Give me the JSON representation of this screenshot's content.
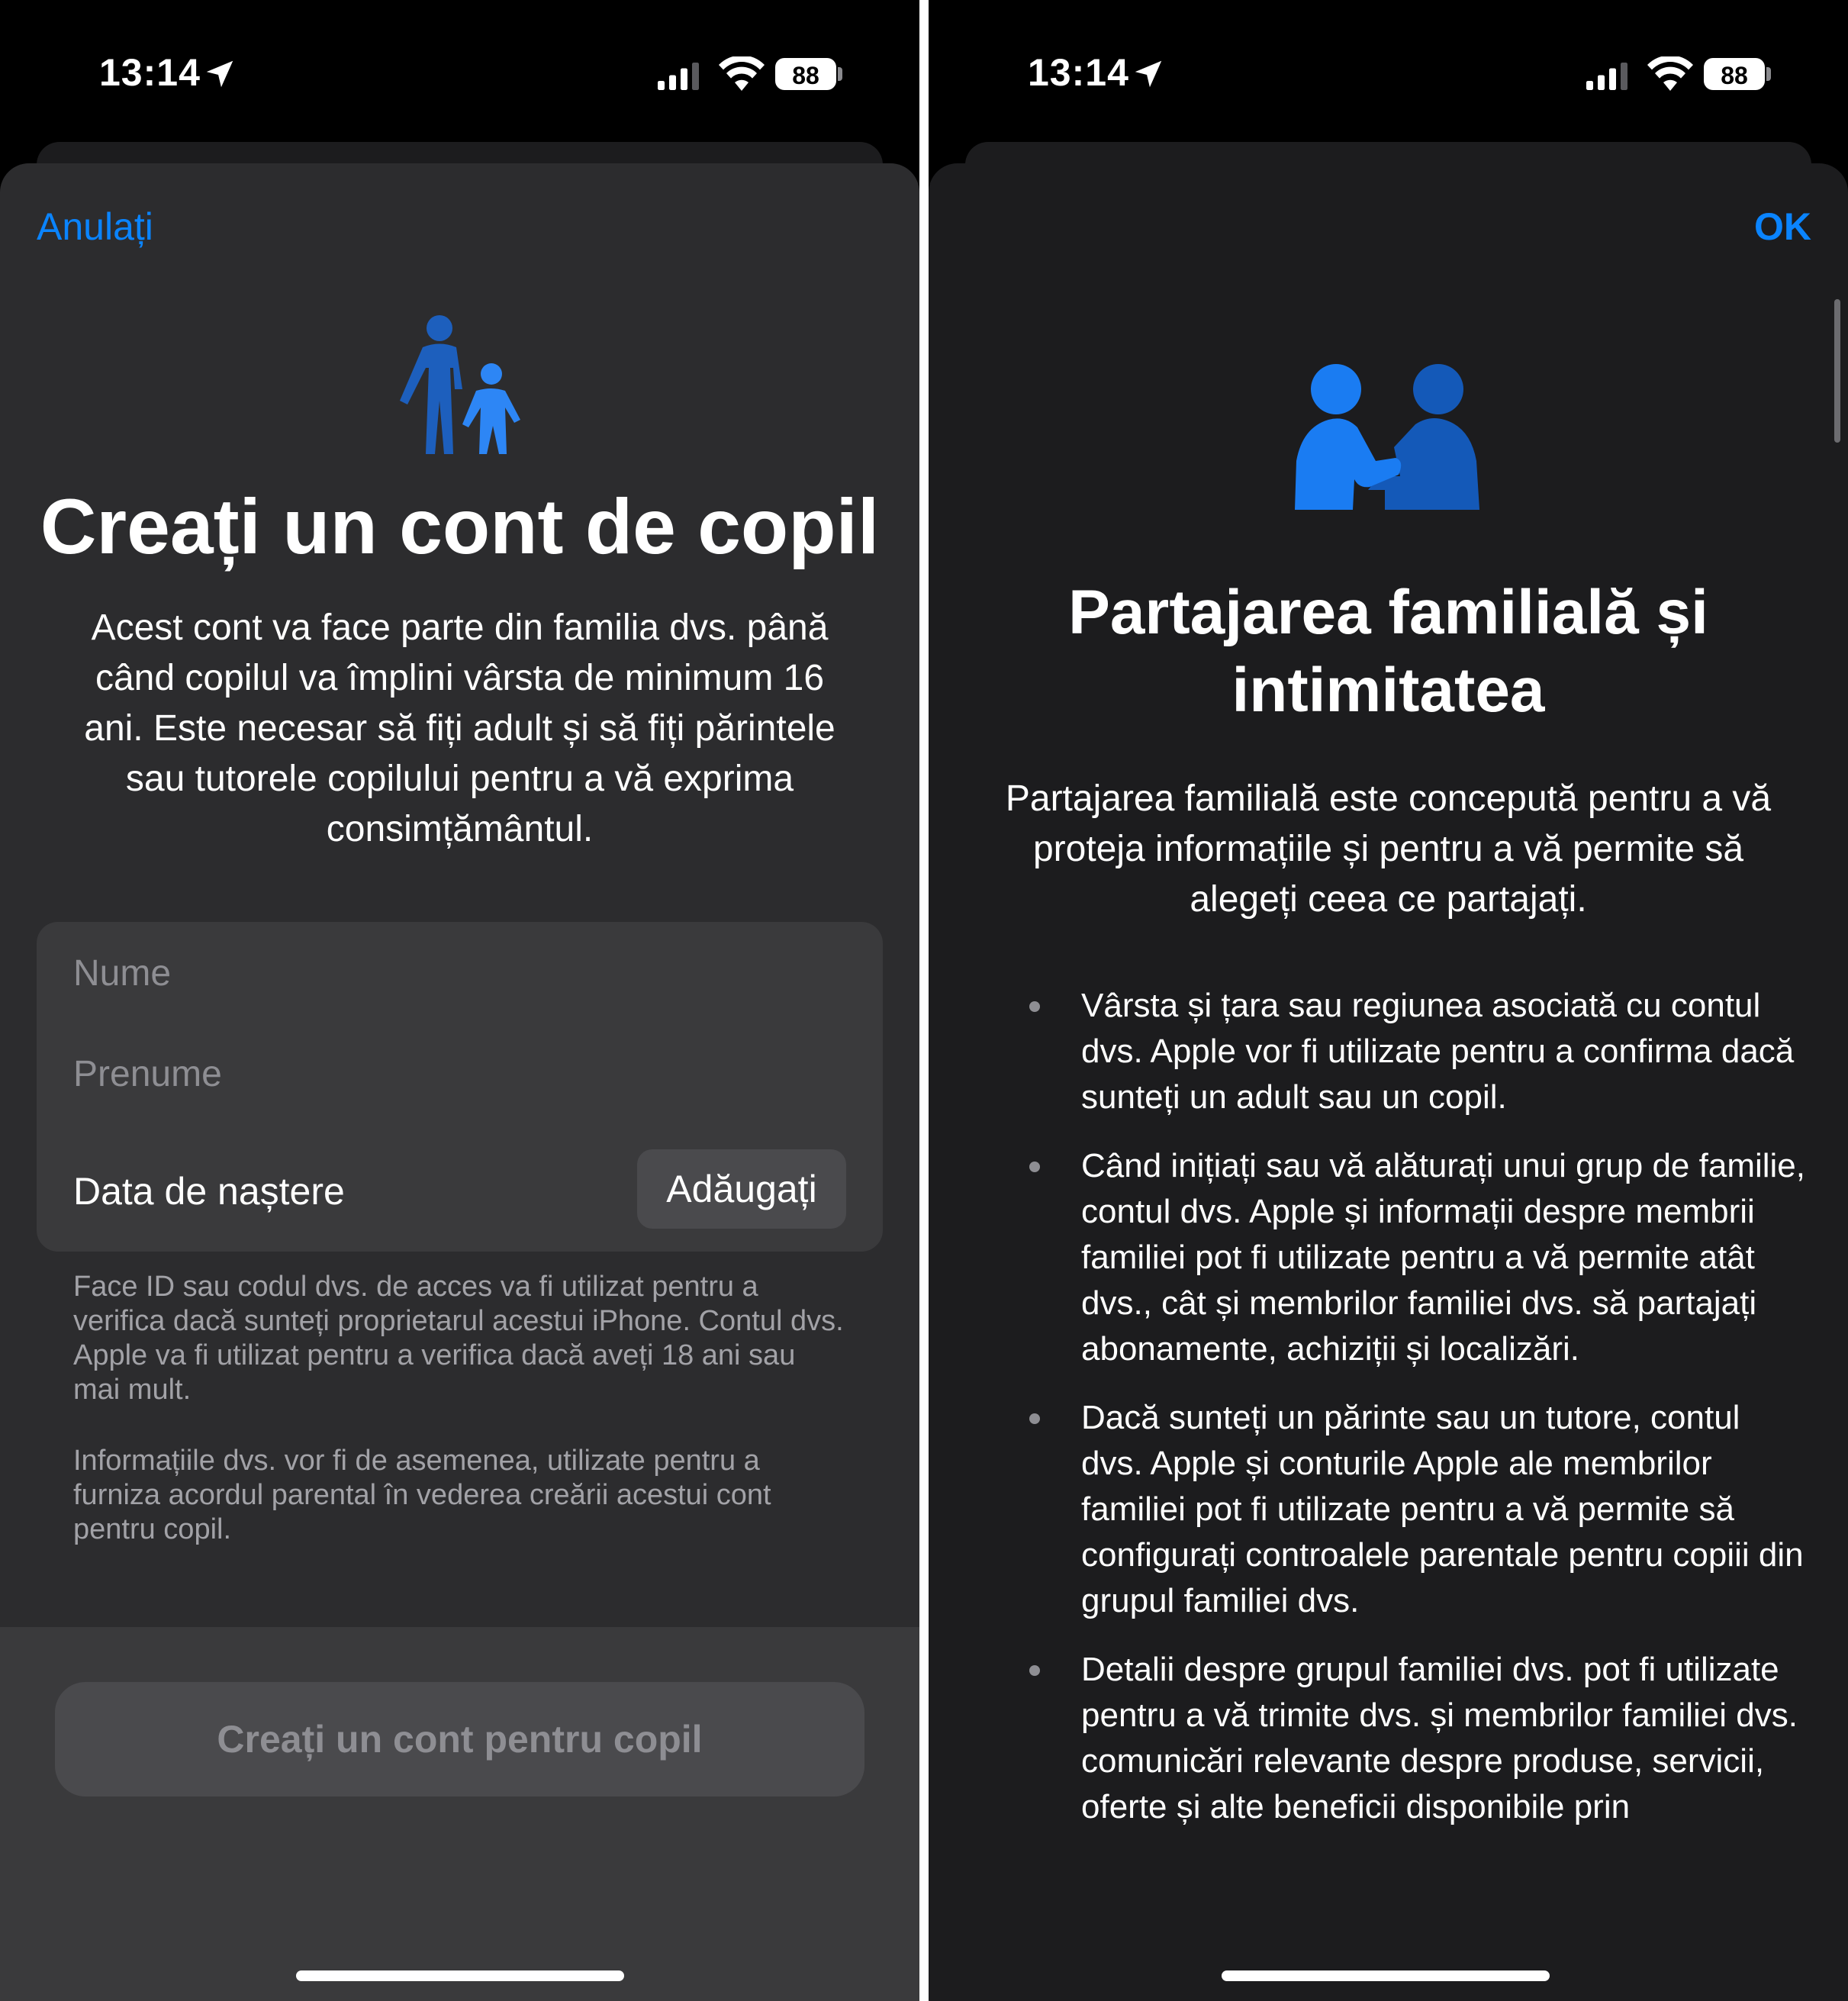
{
  "left": {
    "status": {
      "time": "13:14",
      "battery": "88"
    },
    "cancel_label": "Anulați",
    "title": "Creați un cont de copil",
    "description": "Acest cont va face parte din familia dvs. până când copilul va împlini vârsta de minimum 16 ani. Este necesar să fiți adult și să fiți părintele sau tutorele copilului pentru a vă exprima consimțământul.",
    "form": {
      "name_placeholder": "Nume",
      "surname_placeholder": "Prenume",
      "dob_label": "Data de naștere",
      "add_label": "Adăugați"
    },
    "footnote_1": "Face ID sau codul dvs. de acces va fi utilizat pentru a verifica dacă sunteți proprietarul acestui iPhone. Contul dvs. Apple va fi utilizat pentru a verifica dacă aveți 18 ani sau mai mult.",
    "footnote_2": "Informațiile dvs. vor fi de asemenea, utilizate pentru a furniza acordul parental în vederea creării acestui cont pentru copil.",
    "create_button": "Creați un cont pentru copil",
    "icon": "parent-child-icon",
    "accent_color": "#0a84ff"
  },
  "right": {
    "status": {
      "time": "13:14",
      "battery": "88"
    },
    "ok_label": "OK",
    "icon": "family-handshake-icon",
    "title": "Partajarea familială și intimitatea",
    "description": "Partajarea familială este concepută pentru a vă proteja informațiile și pentru a vă permite să alegeți ceea ce partajați.",
    "bullets": [
      "Vârsta și țara sau regiunea asociată cu contul dvs. Apple vor fi utilizate pentru a confirma dacă sunteți un adult sau un copil.",
      "Când inițiați sau vă alăturați unui grup de familie, contul dvs. Apple și informații despre membrii familiei pot fi utilizate pentru a vă permite atât dvs., cât și membrilor familiei dvs. să partajați abonamente, achiziții și localizări.",
      "Dacă sunteți un părinte sau un tutore, contul dvs. Apple și conturile Apple ale membrilor familiei pot fi utilizate pentru a vă permite să configurați controalele parentale pentru copiii din grupul familiei dvs.",
      "Detalii despre grupul familiei dvs. pot fi utilizate pentru a vă trimite dvs. și membrilor familiei dvs. comunicări relevante despre produse, servicii, oferte și alte beneficii disponibile prin"
    ]
  }
}
